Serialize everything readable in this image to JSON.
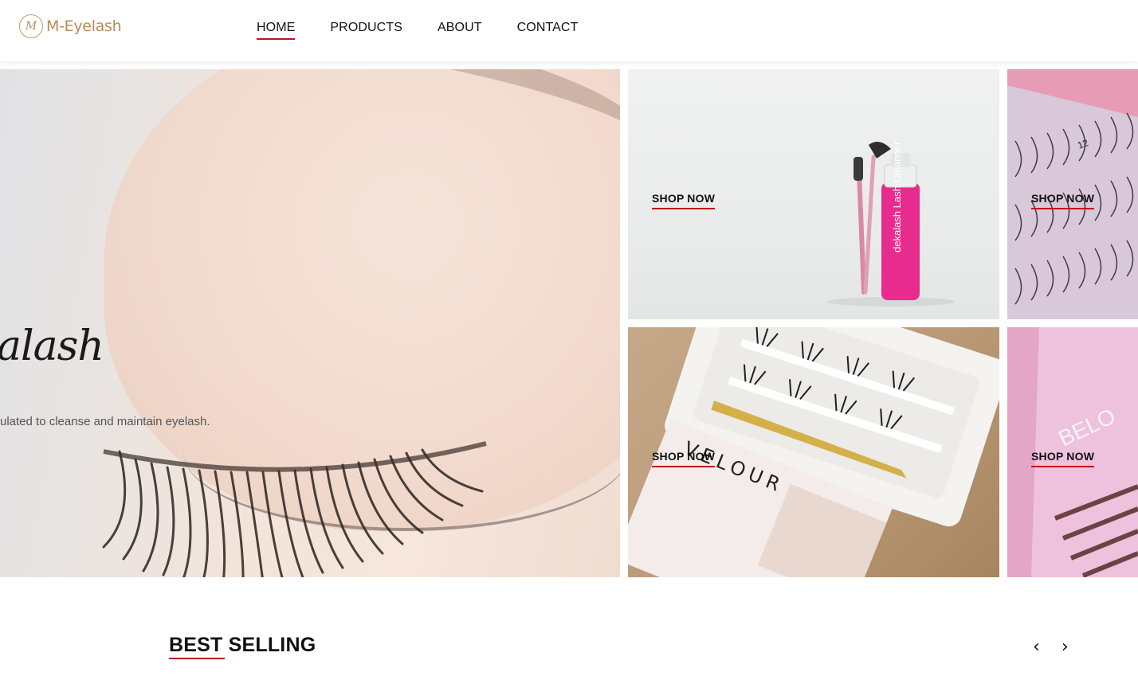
{
  "logo": {
    "text": "M-Eyelash",
    "mark": "M"
  },
  "nav": {
    "items": [
      {
        "label": "HOME",
        "active": true
      },
      {
        "label": "PRODUCTS",
        "active": false
      },
      {
        "label": "ABOUT",
        "active": false
      },
      {
        "label": "CONTACT",
        "active": false
      }
    ]
  },
  "hero": {
    "title": "alash",
    "subtitle": "ulated to cleanse and maintain eyelash."
  },
  "tiles": [
    {
      "cta": "SHOP NOW",
      "product_text": "dekalash Lash Cleanser"
    },
    {
      "cta": "SHOP NOW",
      "product_text": "12"
    },
    {
      "cta": "SHOP NOW",
      "product_text": "VELOUR"
    },
    {
      "cta": "SHOP NOW",
      "product_text": "BELO"
    }
  ],
  "best_selling": {
    "title": "BEST SELLING",
    "prev_icon": "‹",
    "next_icon": "›"
  },
  "colors": {
    "accent": "#c0161c",
    "brand": "#b98a55"
  }
}
